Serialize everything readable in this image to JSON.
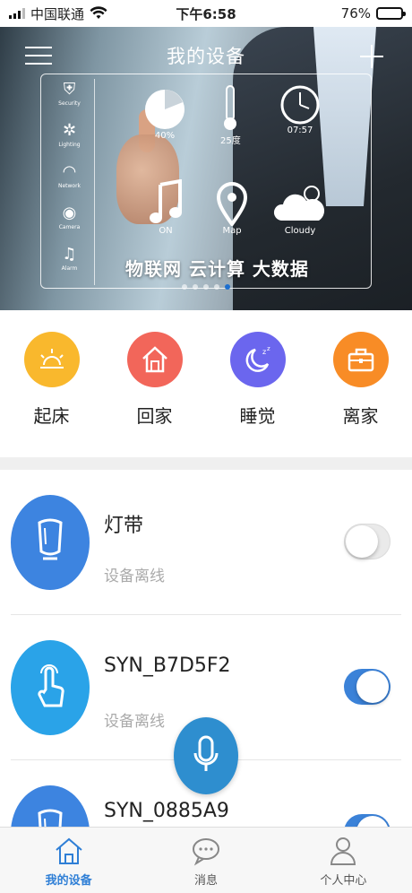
{
  "status_bar": {
    "carrier": "中国联通",
    "time": "下午6:58",
    "battery": "76%",
    "battery_level": 0.76
  },
  "header": {
    "title": "我的设备",
    "menu_icon": "hamburger-icon",
    "add_icon": "plus-icon"
  },
  "banner": {
    "side_items": [
      "Security",
      "Lighting",
      "Network",
      "Camera",
      "Alarm"
    ],
    "icons": [
      {
        "name": "pie-icon",
        "label": "40%"
      },
      {
        "name": "thermometer-icon",
        "label": "25度"
      },
      {
        "name": "clock-icon",
        "label": "07:57"
      },
      {
        "name": "music-icon",
        "label": "ON"
      },
      {
        "name": "map-pin-icon",
        "label": "Map"
      },
      {
        "name": "cloud-icon",
        "label": "Cloudy"
      }
    ],
    "slogan": "物联网 云计算 大数据",
    "slide_count": 5,
    "active_slide": 5
  },
  "scenes": [
    {
      "label": "起床",
      "icon": "sunrise-icon",
      "color": "#f9b82d"
    },
    {
      "label": "回家",
      "icon": "home-icon",
      "color": "#f2665a"
    },
    {
      "label": "睡觉",
      "icon": "moon-icon",
      "color": "#6b66ee"
    },
    {
      "label": "离家",
      "icon": "briefcase-icon",
      "color": "#f88c26"
    }
  ],
  "devices": [
    {
      "name": "灯带",
      "status": "设备离线",
      "icon": "light-strip-icon",
      "color": "#3d84e0",
      "on": false
    },
    {
      "name": "SYN_B7D5F2",
      "status": "设备离线",
      "icon": "touch-icon",
      "color": "#2aa3e8",
      "on": true
    },
    {
      "name": "SYN_0885A9",
      "status": "",
      "icon": "light-strip-icon",
      "color": "#3d84e0",
      "on": true
    }
  ],
  "voice_button": {
    "icon": "microphone-icon",
    "color": "#2e8ecf"
  },
  "tabs": [
    {
      "label": "我的设备",
      "icon": "home-outline-icon",
      "active": true
    },
    {
      "label": "消息",
      "icon": "chat-icon",
      "active": false
    },
    {
      "label": "个人中心",
      "icon": "person-icon",
      "active": false
    }
  ],
  "colors": {
    "accent": "#2f7fd6",
    "toggle_on": "#3b82d8"
  }
}
